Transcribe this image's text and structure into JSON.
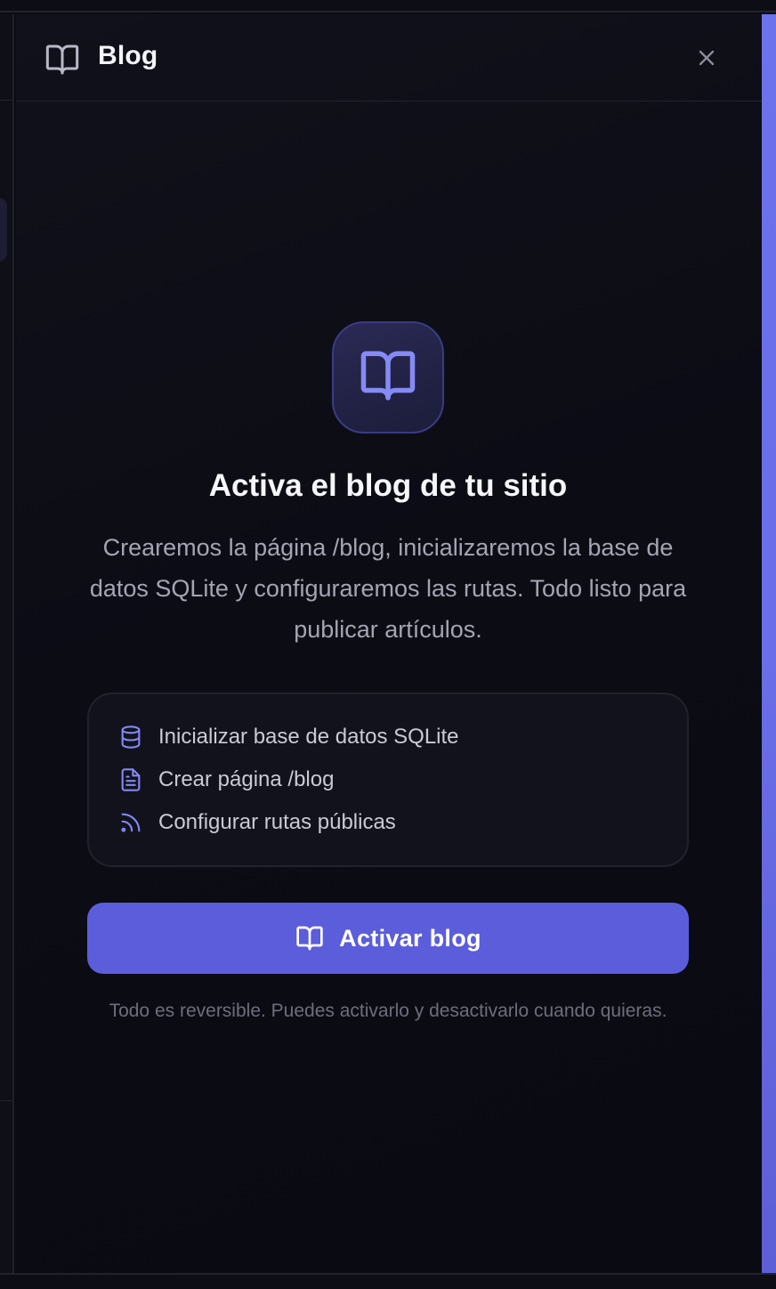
{
  "drawer": {
    "title": "Blog",
    "title_icon": "book-open-icon",
    "close_icon": "close-icon"
  },
  "hero": {
    "icon": "book-open-icon",
    "title": "Activa el blog de tu sitio",
    "description": "Crearemos la página /blog, inicializaremos la base de datos SQLite y configuraremos las rutas. Todo listo para publicar artículos."
  },
  "steps": [
    {
      "icon": "database-icon",
      "label": "Inicializar base de datos SQLite"
    },
    {
      "icon": "file-text-icon",
      "label": "Crear página /blog"
    },
    {
      "icon": "rss-icon",
      "label": "Configurar rutas públicas"
    }
  ],
  "cta": {
    "icon": "book-open-icon",
    "label": "Activar blog"
  },
  "footnote": "Todo es reversible. Puedes activarlo y desactivarlo cuando quieras.",
  "colors": {
    "accent": "#5b5ddb",
    "icon_accent": "#8488f3",
    "background": "#0b0b12",
    "side_accent": "#6a6ee8"
  }
}
